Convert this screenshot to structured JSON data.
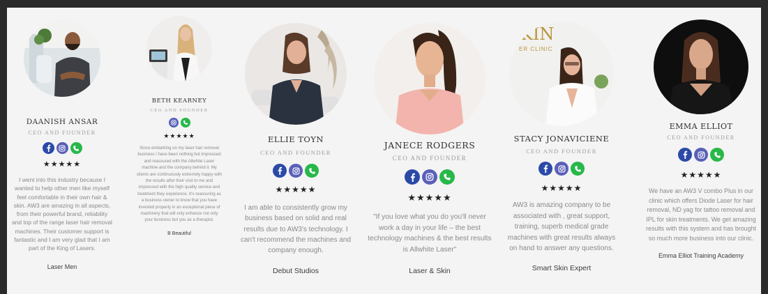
{
  "testimonials": [
    {
      "name": "DAANISH ANSAR",
      "role": "CEO AND FOUNDER",
      "icons": [
        "facebook-icon",
        "instagram-icon",
        "phone-icon"
      ],
      "stars": "★★★★★",
      "quote": "I went into this industry because I wanted to help other men like myself feel comfortable in their own hair & skin. AW3 are amazing in all aspects, from their powerful brand, reliability and top of the range laser hair removal machines. Their customer support is fantastic and I am very glad that I am part of the King of Lasers.",
      "company": "Laser Men"
    },
    {
      "name": "BETH KEARNEY",
      "role": "CEO AND FOUNDER",
      "icons": [
        "instagram-icon",
        "phone-icon"
      ],
      "stars": "★★★★★",
      "quote": "Since embarking on my laser hair removal business I have been nothing but impressed and reassured with the Allwhite Laser machine and the company behind it. My clients are continuously extremely happy with the results after their visit to me and impressed with the high quality service and treatment they experience. It's reassuring as a business owner to know that you have invested properly in an exceptional piece of machinery that will only enhance not only your business but you as a therapist.",
      "company": "B Beautiful"
    },
    {
      "name": "ELLIE TOYN",
      "role": "CEO AND FOUNDER",
      "icons": [
        "facebook-icon",
        "instagram-icon",
        "phone-icon"
      ],
      "stars": "★★★★★",
      "quote": "I am able to consistently grow my business based on solid and real results due to AW3's technology. I can't recommend the machines and company enough.",
      "company": "Debut Studios"
    },
    {
      "name": "JANECE RODGERS",
      "role": "CEO AND FOUNDER",
      "icons": [
        "facebook-icon",
        "instagram-icon",
        "phone-icon"
      ],
      "stars": "★★★★★",
      "quote": "\"If you love what you do you'll never work a day in your life – the best technology machines & the best results is Allwhite Laser\"",
      "company": "Laser & Skin"
    },
    {
      "name": "STACY JONAVICIENE",
      "role": "CEO AND FOUNDER",
      "icons": [
        "facebook-icon",
        "instagram-icon",
        "phone-icon"
      ],
      "stars": "★★★★★",
      "quote": "AW3 is amazing company to be associated with , great support, training, superb medical grade machines with great results always on hand to answer any questions.",
      "company": "Smart Skin Expert"
    },
    {
      "name": "EMMA ELLIOT",
      "role": "CEO AND FOUNDER",
      "icons": [
        "facebook-icon",
        "instagram-icon",
        "phone-icon"
      ],
      "stars": "★★★★★",
      "quote": "We have an AW3 V combo Plus in our clinic which offers Diode Laser for hair removal, ND yag for tattoo removal and IPL for skin treatments. We get amazing results with this system and has brought so much more business into our clinic.",
      "company": "Emma Elliot Training Academy"
    }
  ],
  "photo_sign_text": "KIN",
  "photo_sign_subtext": "ER CLINIC"
}
